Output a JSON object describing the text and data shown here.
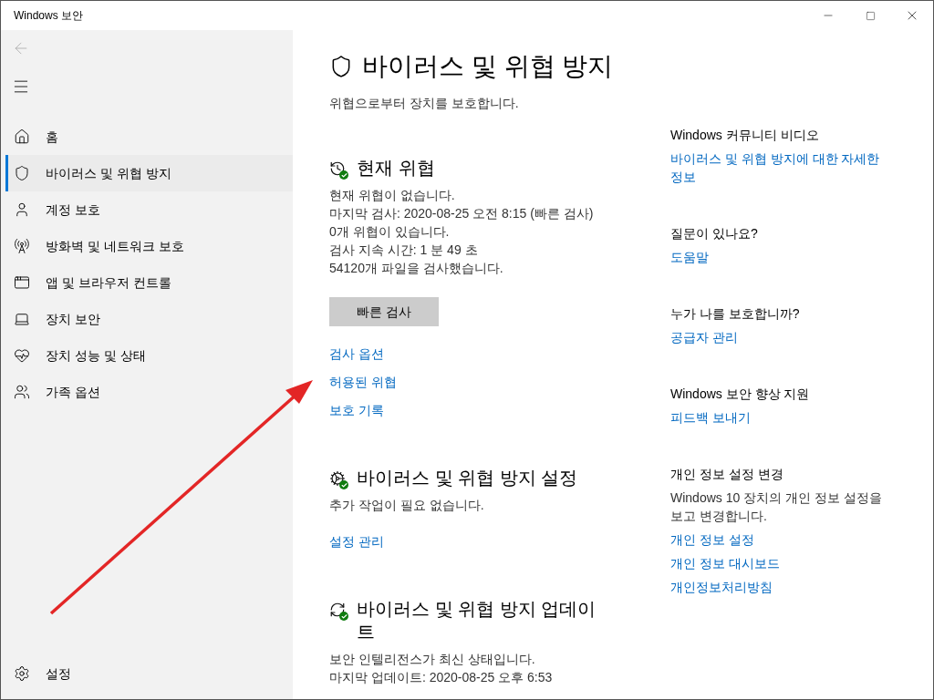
{
  "window": {
    "title": "Windows 보안"
  },
  "sidebar": {
    "items": [
      {
        "label": "홈",
        "selected": false
      },
      {
        "label": "바이러스 및 위협 방지",
        "selected": true
      },
      {
        "label": "계정 보호",
        "selected": false
      },
      {
        "label": "방화벽 및 네트워크 보호",
        "selected": false
      },
      {
        "label": "앱 및 브라우저 컨트롤",
        "selected": false
      },
      {
        "label": "장치 보안",
        "selected": false
      },
      {
        "label": "장치 성능 및 상태",
        "selected": false
      },
      {
        "label": "가족 옵션",
        "selected": false
      }
    ],
    "settings": {
      "label": "설정"
    }
  },
  "page": {
    "title": "바이러스 및 위협 방지",
    "subtitle": "위협으로부터 장치를 보호합니다."
  },
  "sections": [
    {
      "heading": "현재 위협",
      "lines": [
        "현재 위협이 없습니다.",
        "마지막 검사: 2020-08-25 오전 8:15 (빠른 검사)",
        "0개 위협이 있습니다.",
        "검사 지속 시간: 1 분 49 초",
        "54120개 파일을 검사했습니다."
      ],
      "button": "빠른 검사",
      "links": [
        "검사 옵션",
        "허용된 위협",
        "보호 기록"
      ]
    },
    {
      "heading": "바이러스 및 위협 방지 설정",
      "lines": [
        "추가 작업이 필요 없습니다."
      ],
      "links": [
        "설정 관리"
      ]
    },
    {
      "heading": "바이러스 및 위협 방지 업데이트",
      "lines": [
        "보안 인텔리전스가 최신 상태입니다.",
        "마지막 업데이트: 2020-08-25 오후 6:53"
      ]
    }
  ],
  "aside": [
    {
      "heading": "Windows 커뮤니티 비디오",
      "links": [
        "바이러스 및 위협 방지에 대한 자세한 정보"
      ]
    },
    {
      "heading": "질문이 있나요?",
      "links": [
        "도움말"
      ]
    },
    {
      "heading": "누가 나를 보호합니까?",
      "links": [
        "공급자 관리"
      ]
    },
    {
      "heading": "Windows 보안 향상 지원",
      "links": [
        "피드백 보내기"
      ]
    },
    {
      "heading": "개인 정보 설정 변경",
      "text": "Windows 10 장치의 개인 정보 설정을 보고 변경합니다.",
      "links": [
        "개인 정보 설정",
        "개인 정보 대시보드",
        "개인정보처리방침"
      ]
    }
  ]
}
